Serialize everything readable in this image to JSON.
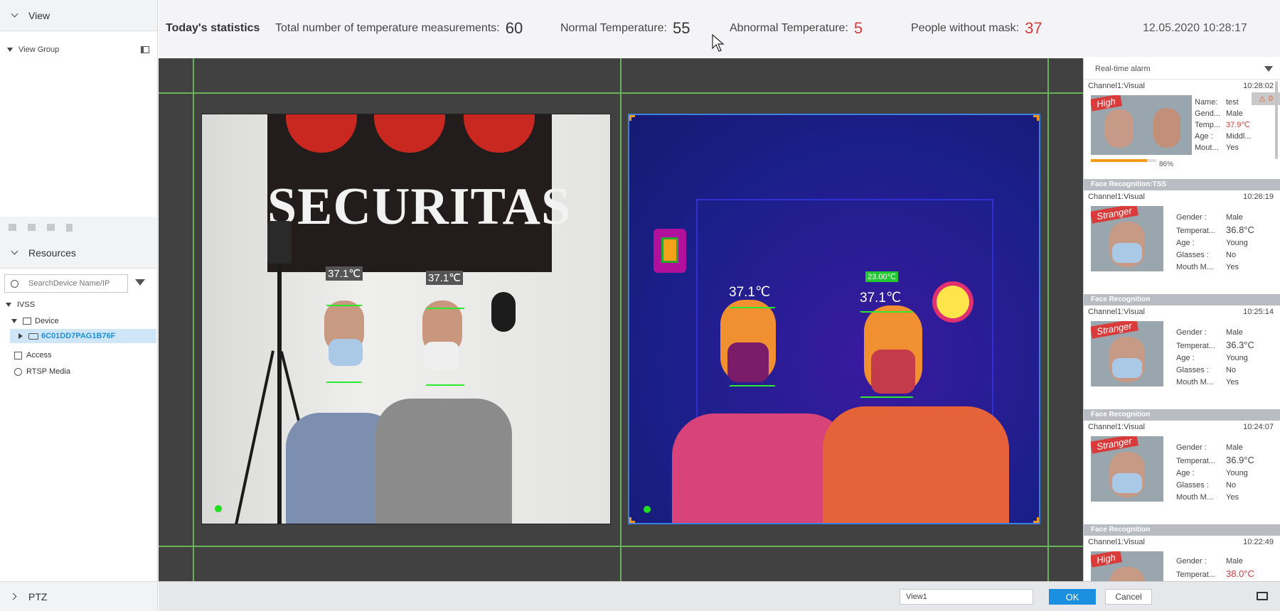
{
  "sidebar": {
    "view_title": "View",
    "view_group_label": "View Group",
    "resources_title": "Resources",
    "search_placeholder": "SearchDevice Name/IP",
    "tree": {
      "root": "IVSS",
      "device_label": "Device",
      "device_id": "6C01DD7PAG1B76F",
      "access_label": "Access",
      "rtsp_label": "RTSP Media"
    },
    "ptz_label": "PTZ"
  },
  "stats": {
    "title": "Today's statistics",
    "total_label": "Total number of temperature measurements:",
    "total_value": "60",
    "normal_label": "Normal Temperature:",
    "normal_value": "55",
    "abnormal_label": "Abnormal Temperature:",
    "abnormal_value": "5",
    "nomask_label": "People without mask:",
    "nomask_value": "37",
    "datetime": "12.05.2020 10:28:17"
  },
  "video": {
    "cam1_banner": "SECURITAS",
    "cam1_temp_left": "37.1℃",
    "cam1_temp_right": "37.1℃",
    "cam2_temp_left": "37.1℃",
    "cam2_temp_right": "37.1℃",
    "cam2_ref": "23.00℃"
  },
  "alarm_panel": {
    "title": "Real-time alarm",
    "badge_count": "0",
    "cards": [
      {
        "type": "",
        "channel": "Channel1:Visual",
        "time": "10:28:02",
        "tag": "High",
        "percent": "86%",
        "fields": [
          {
            "k": "Name:",
            "v": "test"
          },
          {
            "k": "Gend...",
            "v": "Male"
          },
          {
            "k": "Temp...",
            "v": "37.9℃"
          },
          {
            "k": "Age :",
            "v": "Middl..."
          },
          {
            "k": "Mout...",
            "v": "Yes"
          }
        ]
      },
      {
        "type": "Face Recognition:TSS",
        "channel": "Channel1:Visual",
        "time": "10:26:19",
        "tag": "Stranger",
        "fields": [
          {
            "k": "Gender :",
            "v": "Male"
          },
          {
            "k": "Temperat...",
            "v": "36.8°C"
          },
          {
            "k": "Age :",
            "v": "Young"
          },
          {
            "k": "Glasses :",
            "v": "No"
          },
          {
            "k": "Mouth M...",
            "v": "Yes"
          }
        ]
      },
      {
        "type": "Face Recognition",
        "channel": "Channel1:Visual",
        "time": "10:25:14",
        "tag": "Stranger",
        "fields": [
          {
            "k": "Gender :",
            "v": "Male"
          },
          {
            "k": "Temperat...",
            "v": "36.3°C"
          },
          {
            "k": "Age :",
            "v": "Young"
          },
          {
            "k": "Glasses :",
            "v": "No"
          },
          {
            "k": "Mouth M...",
            "v": "Yes"
          }
        ]
      },
      {
        "type": "Face Recognition",
        "channel": "Channel1:Visual",
        "time": "10:24:07",
        "tag": "Stranger",
        "fields": [
          {
            "k": "Gender :",
            "v": "Male"
          },
          {
            "k": "Temperat...",
            "v": "36.9°C"
          },
          {
            "k": "Age :",
            "v": "Young"
          },
          {
            "k": "Glasses :",
            "v": "No"
          },
          {
            "k": "Mouth M...",
            "v": "Yes"
          }
        ]
      },
      {
        "type": "Face Recognition",
        "channel": "Channel1:Visual",
        "time": "10:22:49",
        "tag": "High",
        "fields": [
          {
            "k": "Gender :",
            "v": "Male"
          },
          {
            "k": "Temperat...",
            "v": "38.0°C"
          }
        ]
      }
    ]
  },
  "bottom": {
    "view_name": "View1",
    "ok_label": "OK",
    "cancel_label": "Cancel"
  },
  "colors": {
    "accent_blue": "#1b8fe0",
    "alarm_red": "#d33a3a",
    "grid_green": "#66b35a"
  }
}
